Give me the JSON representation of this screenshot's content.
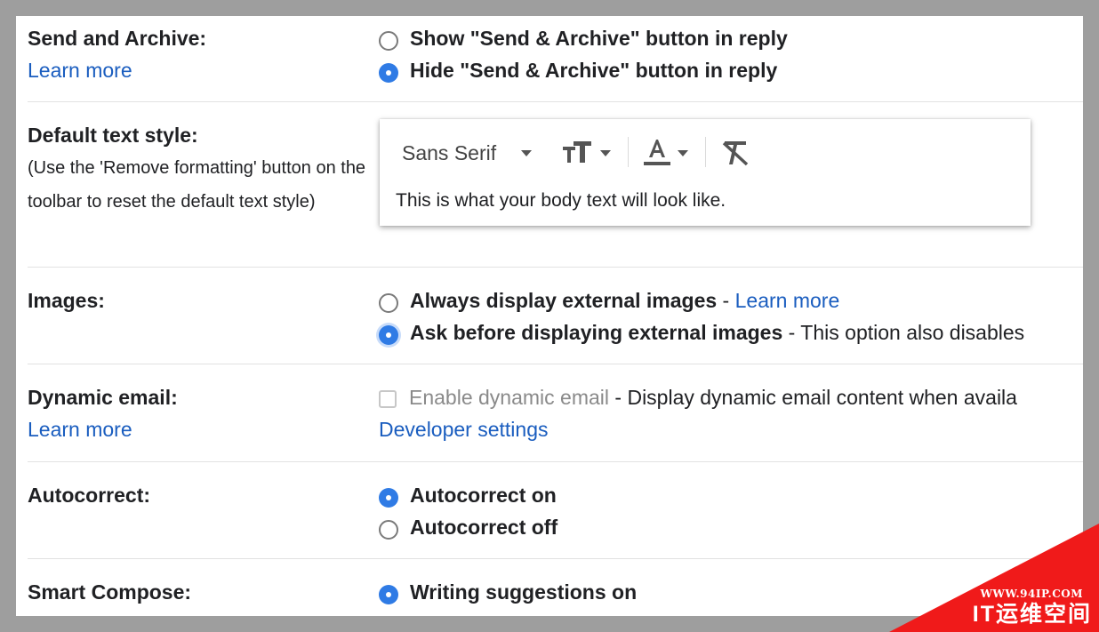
{
  "send_archive": {
    "label": "Send and Archive:",
    "learn_more": "Learn more",
    "options": [
      {
        "label": "Show \"Send & Archive\" button in reply",
        "selected": false
      },
      {
        "label": "Hide \"Send & Archive\" button in reply",
        "selected": true
      }
    ]
  },
  "default_text_style": {
    "label": "Default text style:",
    "description": "(Use the 'Remove formatting' button on the toolbar to reset the default text style)",
    "font": "Sans Serif",
    "preview": "This is what your body text will look like.",
    "icons": [
      "font-caret-icon",
      "text-size-icon",
      "text-color-icon",
      "remove-formatting-icon"
    ]
  },
  "images": {
    "label": "Images:",
    "options": [
      {
        "label": "Always display external images",
        "suffix": " - ",
        "link": "Learn more",
        "selected": false
      },
      {
        "label": "Ask before displaying external images",
        "suffix": " - This option also disables",
        "selected": true
      }
    ]
  },
  "dynamic_email": {
    "label": "Dynamic email:",
    "learn_more": "Learn more",
    "checkbox_label": "Enable dynamic email",
    "checkbox_suffix": " - Display dynamic email content when availa",
    "developer_settings": "Developer settings",
    "checked": false
  },
  "autocorrect": {
    "label": "Autocorrect:",
    "options": [
      {
        "label": "Autocorrect on",
        "selected": true
      },
      {
        "label": "Autocorrect off",
        "selected": false
      }
    ]
  },
  "smart_compose": {
    "label": "Smart Compose:",
    "options": [
      {
        "label": "Writing suggestions on",
        "selected": true
      }
    ]
  },
  "watermark": {
    "url": "WWW.94IP.COM",
    "name": "IT运维空间"
  },
  "colors": {
    "accent": "#2f7be5",
    "link": "#1a5dbf",
    "frame": "#9e9e9e",
    "watermark": "#f01a1a"
  }
}
